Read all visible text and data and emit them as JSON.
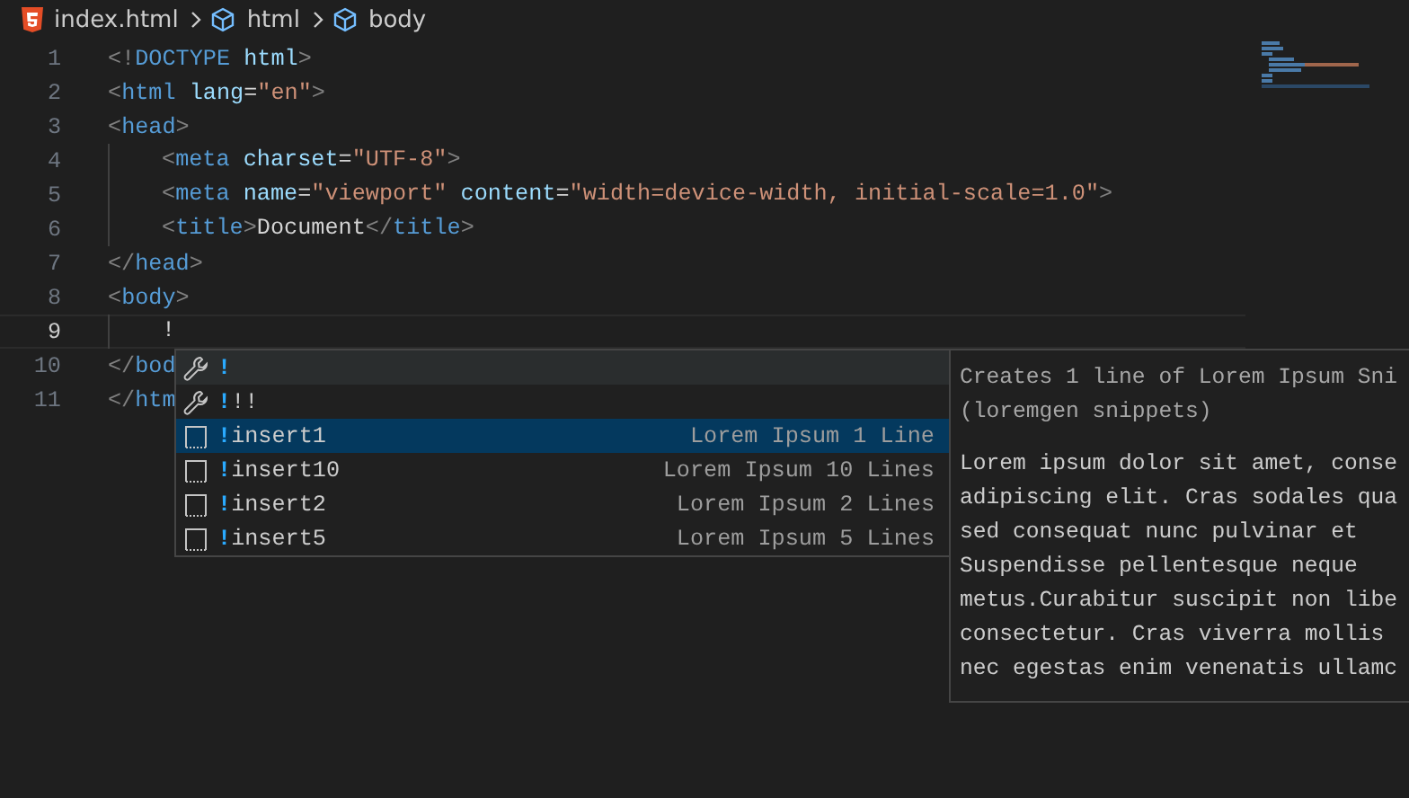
{
  "breadcrumb": [
    {
      "kind": "file",
      "label": "index.html"
    },
    {
      "kind": "symbol",
      "label": "html"
    },
    {
      "kind": "symbol",
      "label": "body"
    }
  ],
  "editor": {
    "lines": [
      {
        "number": "1",
        "current": false,
        "indented": false,
        "tokens": [
          {
            "kind": "punct",
            "text": "<!"
          },
          {
            "kind": "tag",
            "text": "DOCTYPE"
          },
          {
            "kind": "attr",
            "text": " html"
          },
          {
            "kind": "punct",
            "text": ">"
          }
        ]
      },
      {
        "number": "2",
        "current": false,
        "indented": false,
        "tokens": [
          {
            "kind": "punct",
            "text": "<"
          },
          {
            "kind": "tag",
            "text": "html"
          },
          {
            "kind": "attr",
            "text": " lang"
          },
          {
            "kind": "text",
            "text": "="
          },
          {
            "kind": "string",
            "text": "\"en\""
          },
          {
            "kind": "punct",
            "text": ">"
          }
        ]
      },
      {
        "number": "3",
        "current": false,
        "indented": false,
        "tokens": [
          {
            "kind": "punct",
            "text": "<"
          },
          {
            "kind": "tag",
            "text": "head"
          },
          {
            "kind": "punct",
            "text": ">"
          }
        ]
      },
      {
        "number": "4",
        "current": false,
        "indented": true,
        "tokens": [
          {
            "kind": "punct",
            "text": "<"
          },
          {
            "kind": "tag",
            "text": "meta"
          },
          {
            "kind": "attr",
            "text": " charset"
          },
          {
            "kind": "text",
            "text": "="
          },
          {
            "kind": "string",
            "text": "\"UTF-8\""
          },
          {
            "kind": "punct",
            "text": ">"
          }
        ]
      },
      {
        "number": "5",
        "current": false,
        "indented": true,
        "tokens": [
          {
            "kind": "punct",
            "text": "<"
          },
          {
            "kind": "tag",
            "text": "meta"
          },
          {
            "kind": "attr",
            "text": " name"
          },
          {
            "kind": "text",
            "text": "="
          },
          {
            "kind": "string",
            "text": "\"viewport\""
          },
          {
            "kind": "attr",
            "text": " content"
          },
          {
            "kind": "text",
            "text": "="
          },
          {
            "kind": "string",
            "text": "\"width=device-width, initial-scale=1.0\""
          },
          {
            "kind": "punct",
            "text": ">"
          }
        ]
      },
      {
        "number": "6",
        "current": false,
        "indented": true,
        "tokens": [
          {
            "kind": "punct",
            "text": "<"
          },
          {
            "kind": "tag",
            "text": "title"
          },
          {
            "kind": "punct",
            "text": ">"
          },
          {
            "kind": "text",
            "text": "Document"
          },
          {
            "kind": "punct",
            "text": "</"
          },
          {
            "kind": "tag",
            "text": "title"
          },
          {
            "kind": "punct",
            "text": ">"
          }
        ]
      },
      {
        "number": "7",
        "current": false,
        "indented": false,
        "tokens": [
          {
            "kind": "punct",
            "text": "</"
          },
          {
            "kind": "tag",
            "text": "head"
          },
          {
            "kind": "punct",
            "text": ">"
          }
        ]
      },
      {
        "number": "8",
        "current": false,
        "indented": false,
        "tokens": [
          {
            "kind": "punct",
            "text": "<"
          },
          {
            "kind": "tag",
            "text": "body"
          },
          {
            "kind": "punct",
            "text": ">"
          }
        ]
      },
      {
        "number": "9",
        "current": true,
        "indented": true,
        "tokens": [
          {
            "kind": "text",
            "text": "!"
          }
        ]
      },
      {
        "number": "10",
        "current": false,
        "indented": false,
        "tokens": [
          {
            "kind": "punct",
            "text": "</"
          },
          {
            "kind": "tag",
            "text": "bod"
          }
        ]
      },
      {
        "number": "11",
        "current": false,
        "indented": false,
        "tokens": [
          {
            "kind": "punct",
            "text": "</"
          },
          {
            "kind": "tag",
            "text": "htm"
          }
        ]
      }
    ]
  },
  "suggestions": {
    "items": [
      {
        "kind": "wrench",
        "match": "!",
        "selected": false
      },
      {
        "kind": "wrench",
        "match": "!",
        "rest": "!!",
        "selected": false
      },
      {
        "kind": "snippet",
        "match": "!",
        "rest": "insert1",
        "detail": "Lorem Ipsum 1 Line",
        "selected": true
      },
      {
        "kind": "snippet",
        "match": "!",
        "rest": "insert10",
        "detail": "Lorem Ipsum 10 Lines",
        "selected": false
      },
      {
        "kind": "snippet",
        "match": "!",
        "rest": "insert2",
        "detail": "Lorem Ipsum 2 Lines",
        "selected": false
      },
      {
        "kind": "snippet",
        "match": "!",
        "rest": "insert5",
        "detail": "Lorem Ipsum 5 Lines",
        "selected": false
      }
    ],
    "details": {
      "header": [
        "Creates 1 line of Lorem Ipsum Sni",
        "(loremgen snippets)"
      ],
      "body": [
        "Lorem ipsum dolor sit amet, conse",
        "adipiscing elit. Cras sodales qua",
        "sed consequat nunc pulvinar et",
        "Suspendisse pellentesque neque",
        "metus.Curabitur suscipit non libe",
        "consectetur. Cras viverra mollis",
        "nec egestas enim venenatis ullamc"
      ]
    }
  }
}
